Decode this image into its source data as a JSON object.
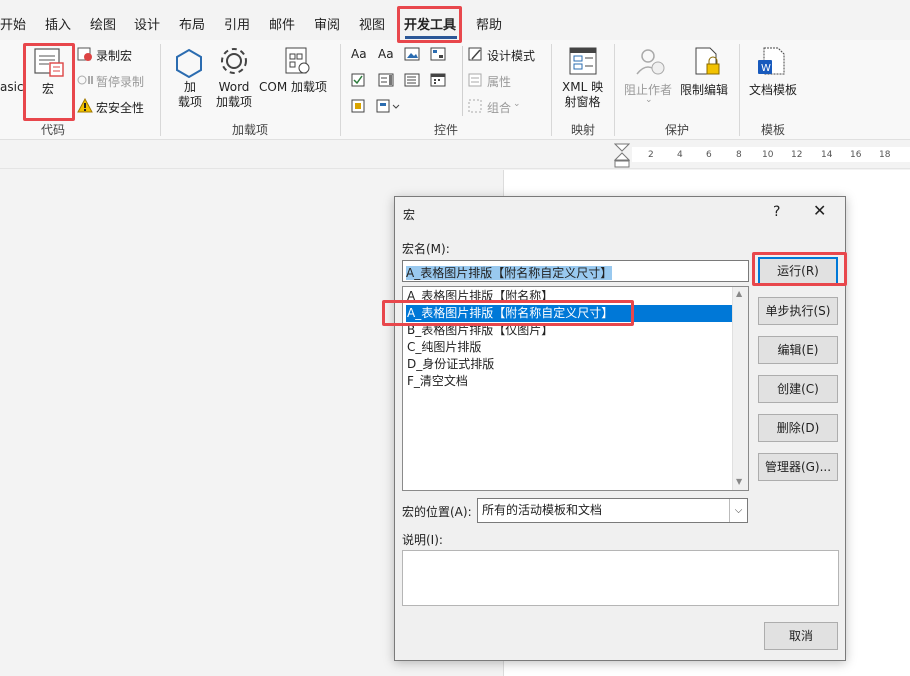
{
  "menu": {
    "tabs": [
      "开始",
      "插入",
      "绘图",
      "设计",
      "布局",
      "引用",
      "邮件",
      "审阅",
      "视图",
      "开发工具",
      "帮助"
    ],
    "active_tab": "开发工具"
  },
  "ribbon": {
    "code": {
      "basic_label": "asic",
      "macro_label": "宏",
      "record_macro": "录制宏",
      "pause_record": "暂停录制",
      "macro_security": "宏安全性",
      "group_label": "代码"
    },
    "addins": {
      "add_label": "加\n载项",
      "word_addins_label": "Word\n加载项",
      "com_addins_label": "COM 加载项",
      "group_label": "加载项"
    },
    "controls": {
      "design_mode": "设计模式",
      "properties": "属性",
      "group": "组合",
      "aa1": "Aa",
      "aa2": "Aa",
      "group_label": "控件"
    },
    "mapping": {
      "xml_label": "XML 映\n射窗格",
      "group_label": "映射"
    },
    "protect": {
      "block_authors": "阻止作者",
      "restrict_editing": "限制编辑",
      "group_label": "保护"
    },
    "templates": {
      "doc_template": "文档模板",
      "group_label": "模板"
    }
  },
  "ruler": {
    "numbers": [
      "2",
      "4",
      "6",
      "8",
      "10",
      "12",
      "14",
      "16",
      "18"
    ]
  },
  "dialog": {
    "title": "宏",
    "help": "?",
    "close": "✕",
    "macro_name_label": "宏名(M):",
    "macro_name_value": "A_表格图片排版【附名称自定义尺寸】",
    "macros": [
      "A_表格图片排版【附名称】",
      "A_表格图片排版【附名称自定义尺寸】",
      "B_表格图片排版【仅图片】",
      "C_纯图片排版",
      "D_身份证式排版",
      "F_清空文档"
    ],
    "selected_index": 1,
    "buttons": {
      "run": "运行(R)",
      "step_into": "单步执行(S)",
      "edit": "编辑(E)",
      "create": "创建(C)",
      "delete": "删除(D)",
      "organizer": "管理器(G)...",
      "cancel": "取消"
    },
    "macros_in_label": "宏的位置(A):",
    "macros_in_value": "所有的活动模板和文档",
    "description_label": "说明(I):",
    "description_value": ""
  },
  "colors": {
    "highlight": "#e8474c",
    "selection": "#0078d7",
    "accent": "#2b5797"
  }
}
